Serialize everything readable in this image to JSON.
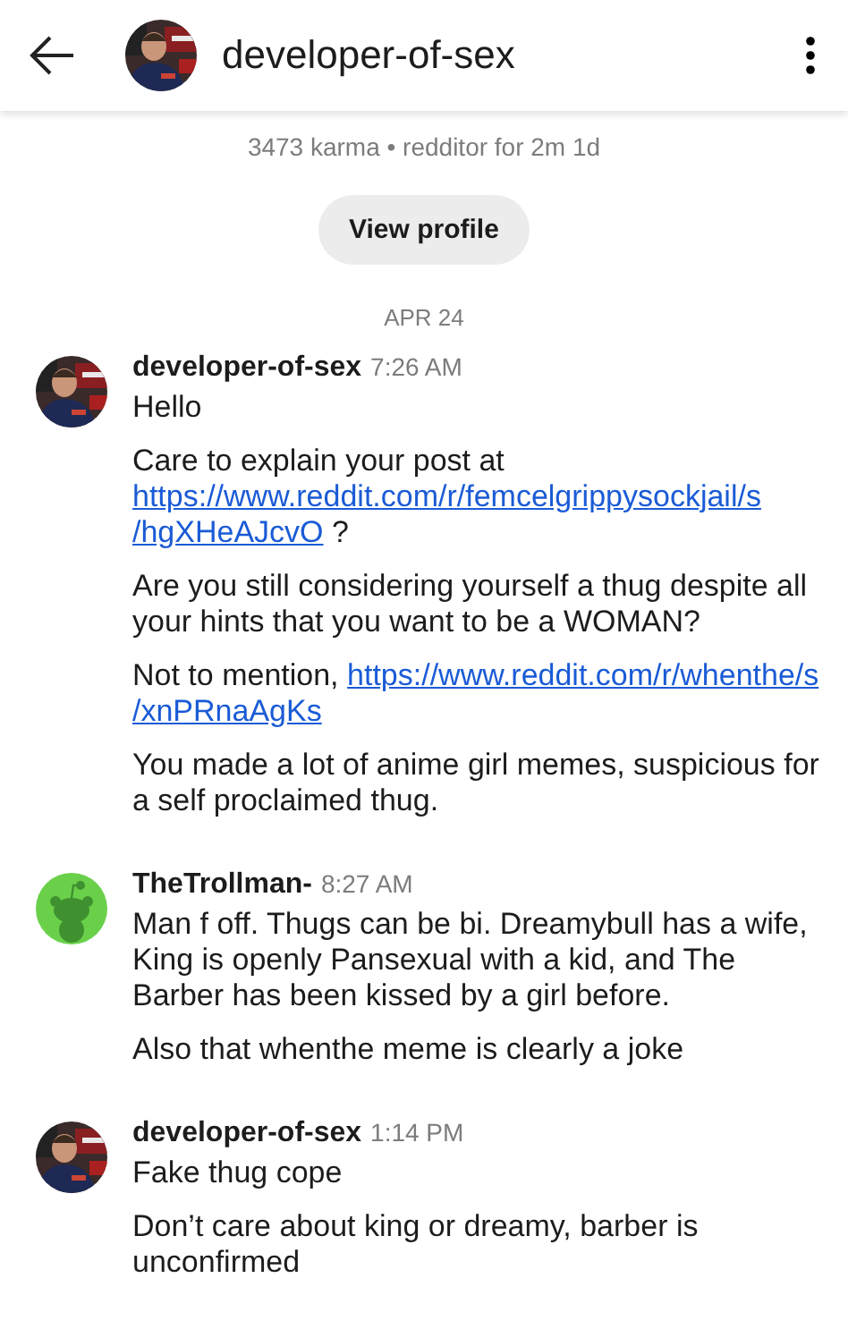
{
  "header": {
    "title": "developer-of-sex",
    "avatar": {
      "kind": "picture"
    }
  },
  "profile": {
    "stats": "3473 karma • redditor for 2m 1d",
    "button": "View profile"
  },
  "date": "APR 24",
  "messages": [
    {
      "author": "developer-of-sex",
      "time": "7:26 AM",
      "avatar": {
        "kind": "picture"
      },
      "paragraphs": [
        [
          {
            "kind": "text",
            "text": "Hello"
          }
        ],
        [
          {
            "kind": "text",
            "text": "Care to explain your post at "
          },
          {
            "kind": "link",
            "text": "https://www.reddit.com/r/femcelgrippysockjail/s"
          },
          {
            "kind": "link",
            "text": "/hgXHeAJcvO"
          },
          {
            "kind": "text",
            "text": " ?"
          }
        ],
        [
          {
            "kind": "text",
            "text": "Are you still considering yourself a thug despite all your hints that you want to be a WOMAN?"
          }
        ],
        [
          {
            "kind": "text",
            "text": "Not to mention, "
          },
          {
            "kind": "link",
            "text": "https://www.reddit.com/r/whenthe/s"
          },
          {
            "kind": "link",
            "text": "/xnPRnaAgKs"
          }
        ],
        [
          {
            "kind": "text",
            "text": "You made a lot of anime girl memes, suspicious for a self proclaimed thug."
          }
        ]
      ]
    },
    {
      "author": "TheTrollman-",
      "time": "8:27 AM",
      "avatar": {
        "kind": "snoo"
      },
      "paragraphs": [
        [
          {
            "kind": "text",
            "text": "Man f off. Thugs can be bi. Dreamybull has a wife, King is openly Pansexual with a kid, and The Barber has been kissed by a girl before."
          }
        ],
        [
          {
            "kind": "text",
            "text": "Also that whenthe meme is clearly a joke"
          }
        ]
      ]
    },
    {
      "author": "developer-of-sex",
      "time": "1:14 PM",
      "avatar": {
        "kind": "picture"
      },
      "paragraphs": [
        [
          {
            "kind": "text",
            "text": "Fake thug cope"
          }
        ],
        [
          {
            "kind": "text",
            "text": "Don’t care about king or dreamy, barber is unconfirmed"
          }
        ]
      ]
    }
  ]
}
